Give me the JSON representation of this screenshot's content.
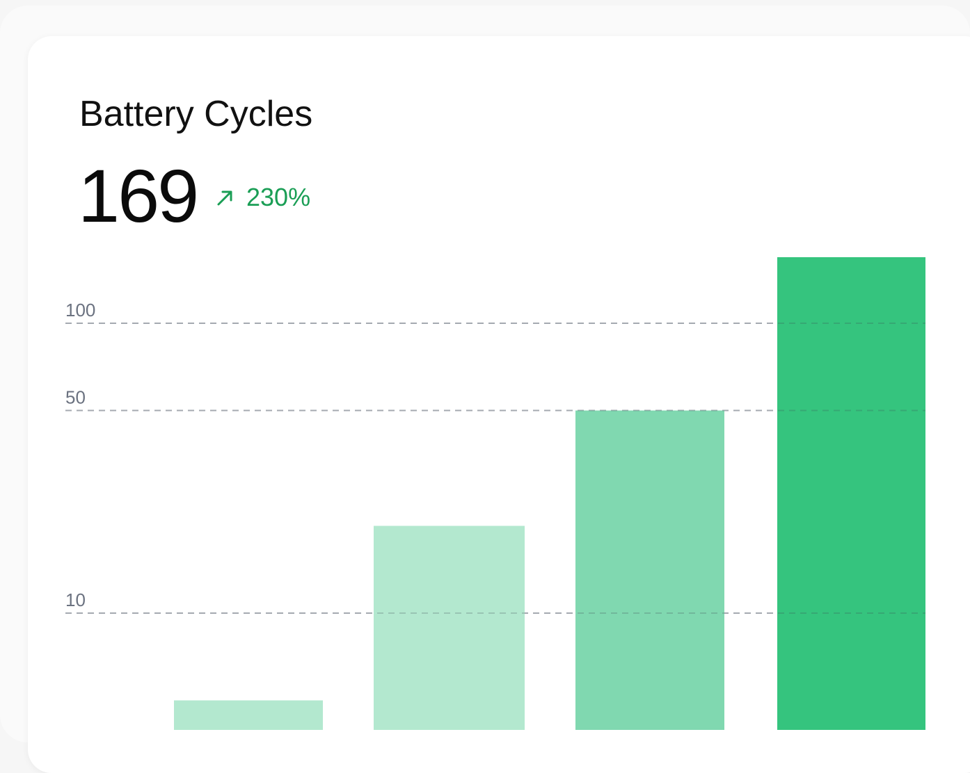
{
  "card": {
    "title": "Battery Cycles",
    "metric_value": "169",
    "delta": {
      "icon": "arrow-up-right-icon",
      "text": "230%",
      "color": "#1a9e55"
    }
  },
  "chart_data": {
    "type": "bar",
    "title": "Battery Cycles",
    "xlabel": "",
    "ylabel": "",
    "scale": "log",
    "yticks": [
      10,
      50,
      100
    ],
    "ytick_labels": [
      "10",
      "50",
      "100"
    ],
    "grid": true,
    "series": [
      {
        "values": [
          5,
          20,
          50,
          169
        ],
        "colors": [
          "#b3e8cf",
          "#b3e8cf",
          "#80d8b0",
          "#35c47e"
        ]
      }
    ]
  }
}
